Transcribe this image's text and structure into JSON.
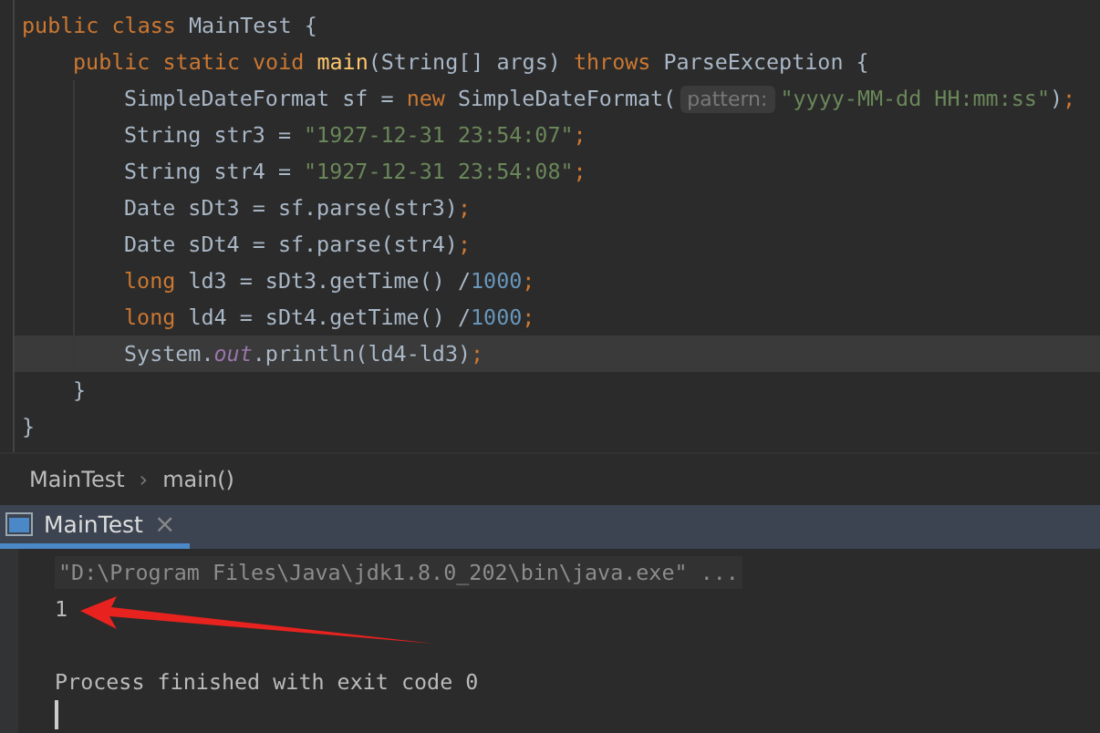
{
  "editor": {
    "lines": [
      {
        "current": false,
        "tokens": [
          {
            "kind": "keyword",
            "text": "public class "
          },
          {
            "kind": "plain",
            "text": "MainTest {"
          }
        ],
        "children": [
          {
            "current": false,
            "tokens": [
              {
                "kind": "keyword",
                "text": "public static void "
              },
              {
                "kind": "method",
                "text": "main"
              },
              {
                "kind": "plain",
                "text": "(String[] args) "
              },
              {
                "kind": "keyword",
                "text": "throws "
              },
              {
                "kind": "plain",
                "text": "ParseException {"
              }
            ],
            "children": [
              {
                "current": false,
                "tokens": [
                  {
                    "kind": "plain",
                    "text": "SimpleDateFormat sf = "
                  },
                  {
                    "kind": "keyword",
                    "text": "new "
                  },
                  {
                    "kind": "plain",
                    "text": "SimpleDateFormat("
                  },
                  {
                    "kind": "hint",
                    "text": "pattern:"
                  },
                  {
                    "kind": "string",
                    "text": "\"yyyy-MM-dd HH:mm:ss\""
                  },
                  {
                    "kind": "plain",
                    "text": ")"
                  },
                  {
                    "kind": "keyword",
                    "text": ";"
                  }
                ]
              },
              {
                "current": false,
                "tokens": [
                  {
                    "kind": "plain",
                    "text": "String str3 = "
                  },
                  {
                    "kind": "string",
                    "text": "\"1927-12-31 23:54:07\""
                  },
                  {
                    "kind": "keyword",
                    "text": ";"
                  }
                ]
              },
              {
                "current": false,
                "tokens": [
                  {
                    "kind": "plain",
                    "text": "String str4 = "
                  },
                  {
                    "kind": "string",
                    "text": "\"1927-12-31 23:54:08\""
                  },
                  {
                    "kind": "keyword",
                    "text": ";"
                  }
                ]
              },
              {
                "current": false,
                "tokens": [
                  {
                    "kind": "plain",
                    "text": "Date sDt3 = sf.parse(str3)"
                  },
                  {
                    "kind": "keyword",
                    "text": ";"
                  }
                ]
              },
              {
                "current": false,
                "tokens": [
                  {
                    "kind": "plain",
                    "text": "Date sDt4 = sf.parse(str4)"
                  },
                  {
                    "kind": "keyword",
                    "text": ";"
                  }
                ]
              },
              {
                "current": false,
                "tokens": [
                  {
                    "kind": "keyword",
                    "text": "long "
                  },
                  {
                    "kind": "plain",
                    "text": "ld3 = sDt3.getTime() /"
                  },
                  {
                    "kind": "number",
                    "text": "1000"
                  },
                  {
                    "kind": "keyword",
                    "text": ";"
                  }
                ]
              },
              {
                "current": false,
                "tokens": [
                  {
                    "kind": "keyword",
                    "text": "long "
                  },
                  {
                    "kind": "plain",
                    "text": "ld4 = sDt4.getTime() /"
                  },
                  {
                    "kind": "number",
                    "text": "1000"
                  },
                  {
                    "kind": "keyword",
                    "text": ";"
                  }
                ]
              },
              {
                "current": true,
                "tokens": [
                  {
                    "kind": "plain",
                    "text": "System."
                  },
                  {
                    "kind": "field",
                    "text": "out"
                  },
                  {
                    "kind": "plain",
                    "text": ".println(ld4-ld3)"
                  },
                  {
                    "kind": "keyword",
                    "text": ";"
                  }
                ]
              }
            ]
          },
          {
            "current": false,
            "tokens": [
              {
                "kind": "plain",
                "text": "}"
              }
            ]
          }
        ]
      },
      {
        "current": false,
        "tokens": [
          {
            "kind": "plain",
            "text": "}"
          }
        ]
      }
    ]
  },
  "breadcrumbs": {
    "items": [
      "MainTest",
      "main()"
    ],
    "separator": "›"
  },
  "run_panel": {
    "tabs": [
      {
        "label": "MainTest",
        "selected": true,
        "close": "×"
      }
    ],
    "console": [
      {
        "kind": "command",
        "text": "\"D:\\Program Files\\Java\\jdk1.8.0_202\\bin\\java.exe\" ..."
      },
      {
        "kind": "output",
        "text": "1"
      },
      {
        "kind": "blank"
      },
      {
        "kind": "output",
        "text": "Process finished with exit code 0"
      },
      {
        "kind": "caret"
      }
    ]
  }
}
